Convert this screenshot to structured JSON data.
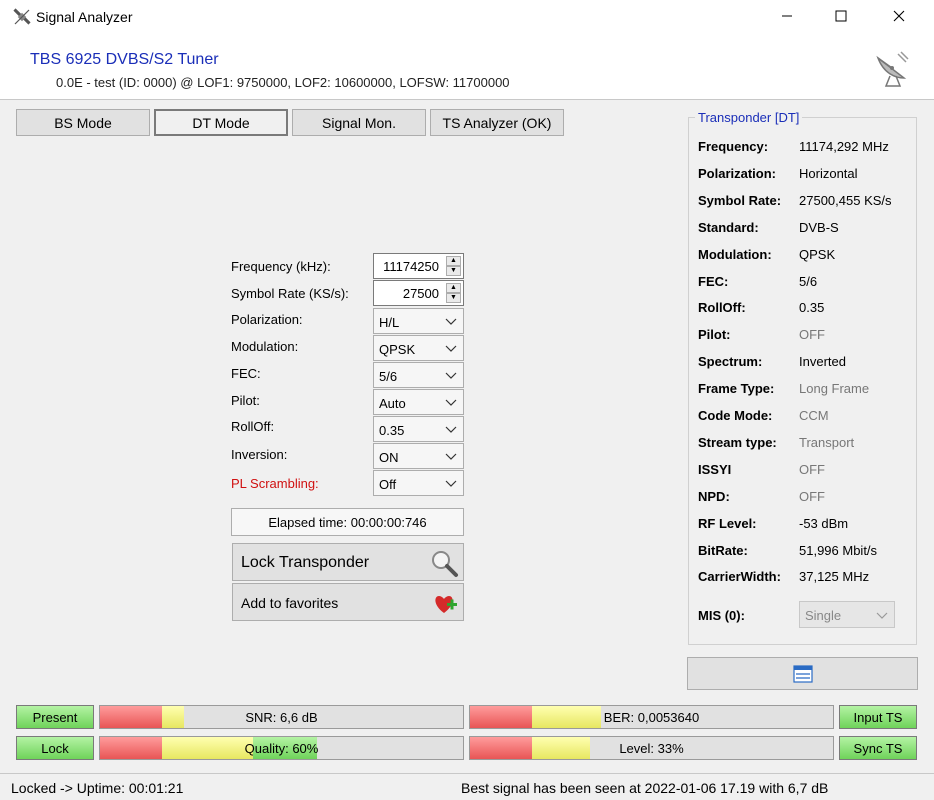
{
  "window": {
    "title": "Signal Analyzer",
    "minimize": "—",
    "maximize": "☐",
    "close": "✕"
  },
  "header": {
    "device": "TBS 6925 DVBS/S2 Tuner",
    "info": "0.0E - test (ID: 0000) @ LOF1: 9750000, LOF2: 10600000, LOFSW: 11700000"
  },
  "modes": {
    "bs": "BS Mode",
    "dt": "DT Mode",
    "signal": "Signal Mon.",
    "ts": "TS Analyzer (OK)",
    "active": "dt"
  },
  "form": {
    "frequency": {
      "label": "Frequency (kHz):",
      "value": "11174250"
    },
    "symbol_rate": {
      "label": "Symbol Rate (KS/s):",
      "value": "27500"
    },
    "polarization": {
      "label": "Polarization:",
      "value": "H/L"
    },
    "modulation": {
      "label": "Modulation:",
      "value": "QPSK"
    },
    "fec": {
      "label": "FEC:",
      "value": "5/6"
    },
    "pilot": {
      "label": "Pilot:",
      "value": "Auto"
    },
    "rolloff": {
      "label": "RollOff:",
      "value": "0.35"
    },
    "inversion": {
      "label": "Inversion:",
      "value": "ON"
    },
    "pl_scrambling": {
      "label": "PL Scrambling:",
      "value": "Off",
      "color": "#d01010"
    }
  },
  "elapsed": "Elapsed time: 00:00:00:746",
  "lock_button": "Lock Transponder",
  "favorites_button": "Add to favorites",
  "transponder": {
    "title": "Transponder [DT]",
    "rows": [
      {
        "label": "Frequency:",
        "value": "11174,292 MHz",
        "dim": false
      },
      {
        "label": "Polarization:",
        "value": "Horizontal",
        "dim": false
      },
      {
        "label": "Symbol Rate:",
        "value": "27500,455 KS/s",
        "dim": false
      },
      {
        "label": "Standard:",
        "value": "DVB-S",
        "dim": false
      },
      {
        "label": "Modulation:",
        "value": "QPSK",
        "dim": false
      },
      {
        "label": "FEC:",
        "value": "5/6",
        "dim": false
      },
      {
        "label": "RollOff:",
        "value": "0.35",
        "dim": false
      },
      {
        "label": "Pilot:",
        "value": "OFF",
        "dim": true
      },
      {
        "label": "Spectrum:",
        "value": "Inverted",
        "dim": false
      },
      {
        "label": "Frame Type:",
        "value": "Long Frame",
        "dim": true
      },
      {
        "label": "Code Mode:",
        "value": "CCM",
        "dim": true
      },
      {
        "label": "Stream type:",
        "value": "Transport",
        "dim": true
      },
      {
        "label": "ISSYI",
        "value": "OFF",
        "dim": true
      },
      {
        "label": "NPD:",
        "value": "OFF",
        "dim": true
      },
      {
        "label": "RF Level:",
        "value": "-53 dBm",
        "dim": false
      },
      {
        "label": "BitRate:",
        "value": "51,996 Mbit/s",
        "dim": false
      },
      {
        "label": "CarrierWidth:",
        "value": "37,125 MHz",
        "dim": false
      }
    ],
    "mis_label": "MIS (0):",
    "mis_value": "Single"
  },
  "indicators": {
    "present": "Present",
    "lock": "Lock",
    "input_ts": "Input TS",
    "sync_ts": "Sync TS"
  },
  "meters": {
    "snr": {
      "text": "SNR: 6,6 dB",
      "level": 0.23
    },
    "ber": {
      "text": "BER: 0,0053640",
      "level": 0.36
    },
    "quality": {
      "text": "Quality: 60%",
      "level": 0.6
    },
    "level": {
      "text": "Level: 33%",
      "level": 0.33
    }
  },
  "status": {
    "left": "Locked -> Uptime: 00:01:21",
    "right": "Best signal has been seen at 2022-01-06 17.19 with 6,7 dB"
  }
}
